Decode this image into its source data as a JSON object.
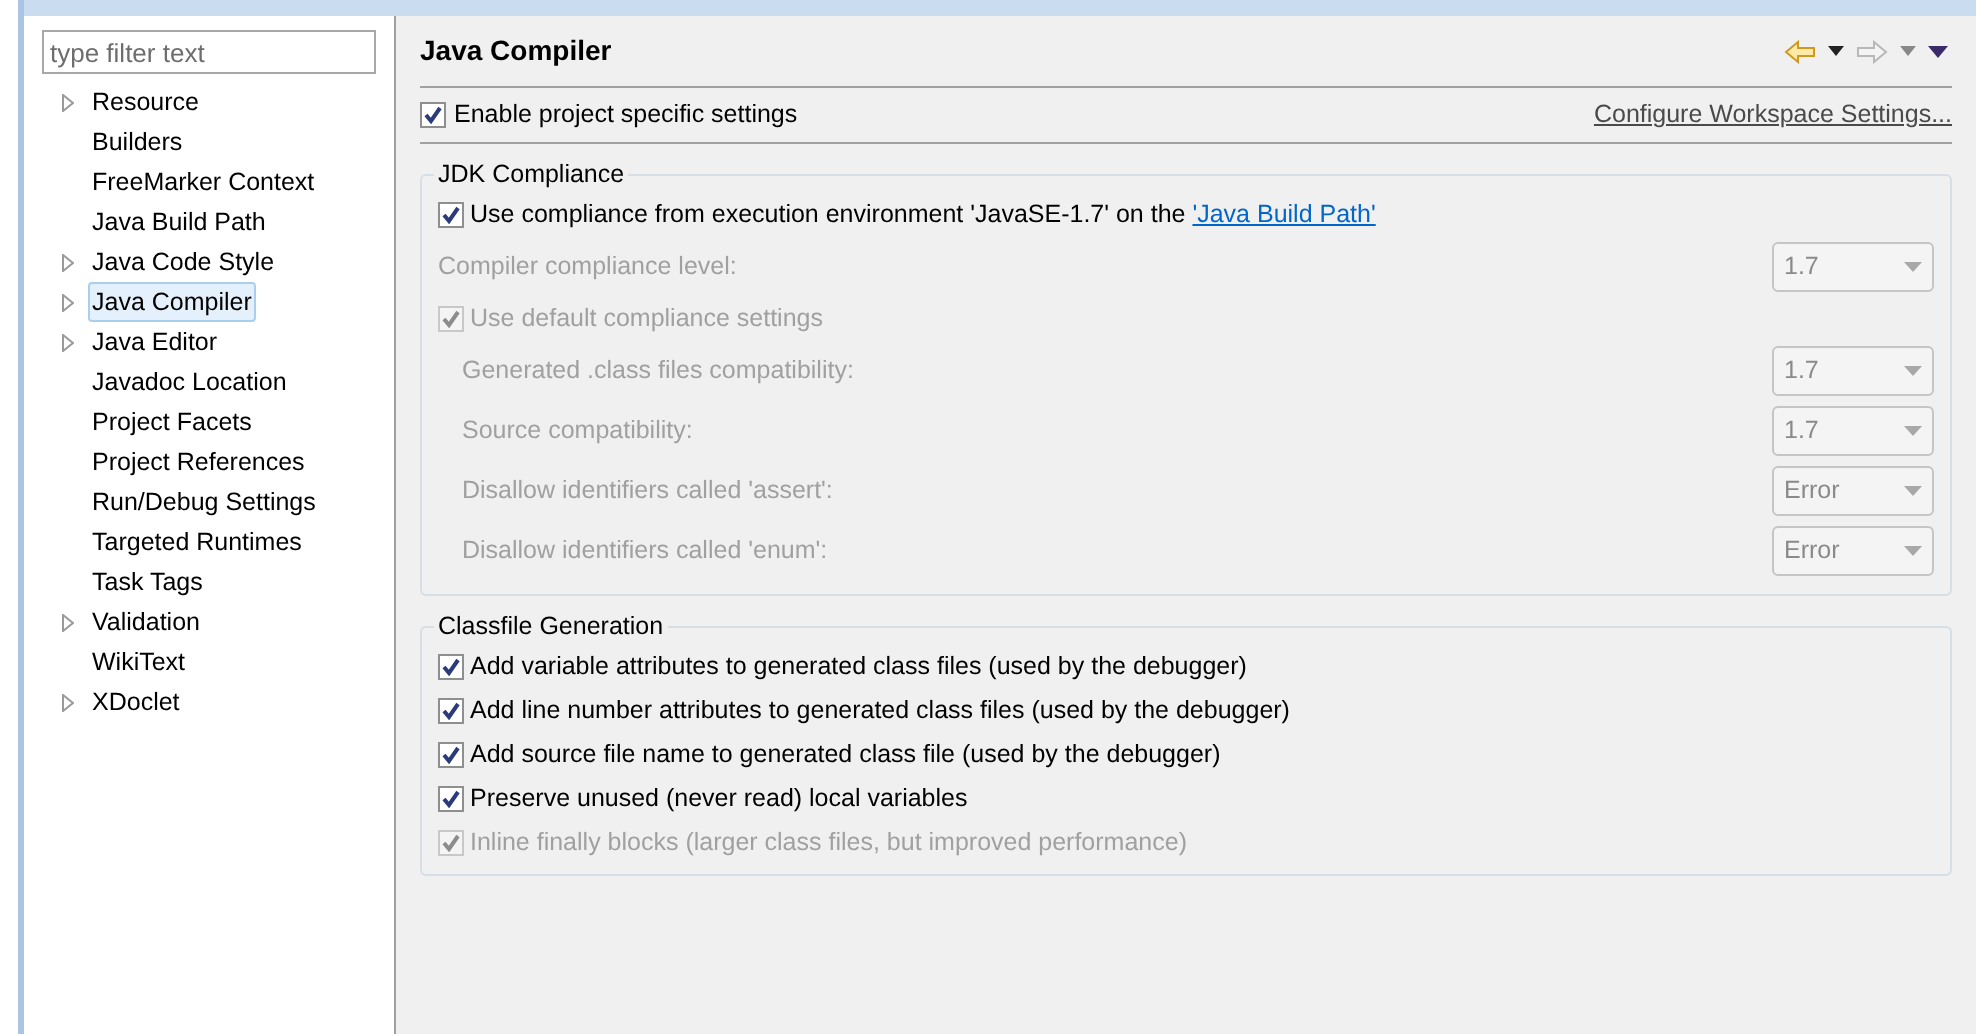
{
  "sidebar": {
    "filter": {
      "placeholder": "type filter text"
    },
    "items": [
      {
        "label": "Resource",
        "expandable": true,
        "selected": false
      },
      {
        "label": "Builders",
        "expandable": false,
        "selected": false
      },
      {
        "label": "FreeMarker Context",
        "expandable": false,
        "selected": false
      },
      {
        "label": "Java Build Path",
        "expandable": false,
        "selected": false
      },
      {
        "label": "Java Code Style",
        "expandable": true,
        "selected": false
      },
      {
        "label": "Java Compiler",
        "expandable": true,
        "selected": true
      },
      {
        "label": "Java Editor",
        "expandable": true,
        "selected": false
      },
      {
        "label": "Javadoc Location",
        "expandable": false,
        "selected": false
      },
      {
        "label": "Project Facets",
        "expandable": false,
        "selected": false
      },
      {
        "label": "Project References",
        "expandable": false,
        "selected": false
      },
      {
        "label": "Run/Debug Settings",
        "expandable": false,
        "selected": false
      },
      {
        "label": "Targeted Runtimes",
        "expandable": false,
        "selected": false
      },
      {
        "label": "Task Tags",
        "expandable": false,
        "selected": false
      },
      {
        "label": "Validation",
        "expandable": true,
        "selected": false
      },
      {
        "label": "WikiText",
        "expandable": false,
        "selected": false
      },
      {
        "label": "XDoclet",
        "expandable": true,
        "selected": false
      }
    ]
  },
  "page": {
    "title": "Java Compiler",
    "enable": {
      "label": "Enable project specific settings",
      "checked": true
    },
    "workspace_link": "Configure Workspace Settings...",
    "jdk": {
      "title": "JDK Compliance",
      "use_env": {
        "label": "Use compliance from execution environment 'JavaSE-1.7' on the ",
        "link": "'Java Build Path'",
        "checked": true
      },
      "level": {
        "label": "Compiler compliance level:",
        "value": "1.7",
        "disabled": true
      },
      "use_default": {
        "label": "Use default compliance settings",
        "checked": true,
        "disabled": true
      },
      "settings": [
        {
          "label": "Generated .class files compatibility:",
          "value": "1.7",
          "disabled": true
        },
        {
          "label": "Source compatibility:",
          "value": "1.7",
          "disabled": true
        },
        {
          "label": "Disallow identifiers called 'assert':",
          "value": "Error",
          "disabled": true
        },
        {
          "label": "Disallow identifiers called 'enum':",
          "value": "Error",
          "disabled": true
        }
      ]
    },
    "classfile": {
      "title": "Classfile Generation",
      "options": [
        {
          "label": "Add variable attributes to generated class files (used by the debugger)",
          "checked": true,
          "disabled": false
        },
        {
          "label": "Add line number attributes to generated class files (used by the debugger)",
          "checked": true,
          "disabled": false
        },
        {
          "label": "Add source file name to generated class file (used by the debugger)",
          "checked": true,
          "disabled": false
        },
        {
          "label": "Preserve unused (never read) local variables",
          "checked": true,
          "disabled": false
        },
        {
          "label": "Inline finally blocks (larger class files, but improved performance)",
          "checked": true,
          "disabled": true
        }
      ]
    }
  }
}
